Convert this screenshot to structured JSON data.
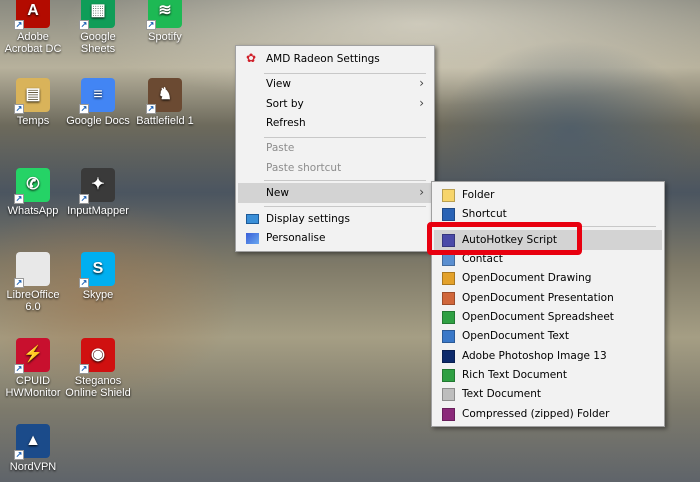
{
  "desktop": {
    "icons": [
      {
        "label": "Adobe Acrobat DC",
        "color": "#b30b00",
        "glyph": "A"
      },
      {
        "label": "Google Sheets",
        "color": "#0f9d58",
        "glyph": "▦"
      },
      {
        "label": "Spotify",
        "color": "#1db954",
        "glyph": "≋"
      },
      {
        "label": "Temps",
        "color": "#d9b35a",
        "glyph": "▤"
      },
      {
        "label": "Google Docs",
        "color": "#4285f4",
        "glyph": "≡"
      },
      {
        "label": "Battlefield 1",
        "color": "#6b4a32",
        "glyph": "♞"
      },
      {
        "label": "WhatsApp",
        "color": "#25d366",
        "glyph": "✆"
      },
      {
        "label": "InputMapper",
        "color": "#3a3a3a",
        "glyph": "✦"
      },
      {
        "label": "LibreOffice 6.0",
        "color": "#e8e8e8",
        "glyph": ""
      },
      {
        "label": "Skype",
        "color": "#00aff0",
        "glyph": "S"
      },
      {
        "label": "CPUID HWMonitor",
        "color": "#c8102e",
        "glyph": "⚡"
      },
      {
        "label": "Steganos Online Shield",
        "color": "#d01010",
        "glyph": "◉"
      },
      {
        "label": "NordVPN",
        "color": "#1b4b8a",
        "glyph": "▲"
      }
    ]
  },
  "context_menu": {
    "amd": "AMD Radeon Settings",
    "view": "View",
    "sort_by": "Sort by",
    "refresh": "Refresh",
    "paste": "Paste",
    "paste_shortcut": "Paste shortcut",
    "new": "New",
    "display_settings": "Display settings",
    "personalise": "Personalise"
  },
  "new_submenu": {
    "items": [
      {
        "label": "Folder",
        "color": "#f7d56b"
      },
      {
        "label": "Shortcut",
        "color": "#2a63b5"
      },
      {
        "label": "AutoHotkey Script",
        "color": "#4a4aa8"
      },
      {
        "label": "Contact",
        "color": "#5b8fd0"
      },
      {
        "label": "OpenDocument Drawing",
        "color": "#e3a12a"
      },
      {
        "label": "OpenDocument Presentation",
        "color": "#d0663a"
      },
      {
        "label": "OpenDocument Spreadsheet",
        "color": "#2fa043"
      },
      {
        "label": "OpenDocument Text",
        "color": "#3a78c8"
      },
      {
        "label": "Adobe Photoshop Image 13",
        "color": "#0d2a6b"
      },
      {
        "label": "Rich Text Document",
        "color": "#2fa043"
      },
      {
        "label": "Text Document",
        "color": "#bdbdbd"
      },
      {
        "label": "Compressed (zipped) Folder",
        "color": "#8b2a7a"
      }
    ]
  },
  "highlight_color": "#e8000f"
}
